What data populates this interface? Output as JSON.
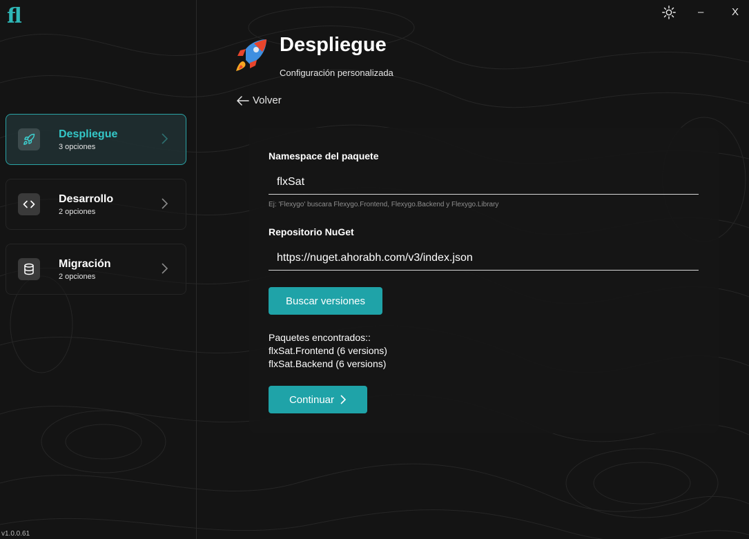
{
  "app": {
    "logo_text": "fl",
    "version": "v1.0.0.61"
  },
  "window_controls": {
    "theme_icon": "sun-icon",
    "minimize": "–",
    "close": "X"
  },
  "sidebar": {
    "items": [
      {
        "title": "Despliegue",
        "subtitle": "3 opciones",
        "icon": "rocket-icon",
        "active": true
      },
      {
        "title": "Desarrollo",
        "subtitle": "2 opciones",
        "icon": "code-icon",
        "active": false
      },
      {
        "title": "Migración",
        "subtitle": "2 opciones",
        "icon": "database-icon",
        "active": false
      }
    ]
  },
  "header": {
    "title": "Despliegue",
    "subtitle": "Configuración personalizada",
    "back_label": "Volver"
  },
  "form": {
    "namespace_label": "Namespace del paquete",
    "namespace_value": "flxSat",
    "namespace_hint": "Ej: 'Flexygo' buscara Flexygo.Frontend, Flexygo.Backend y Flexygo.Library",
    "repo_label": "Repositorio NuGet",
    "repo_value": "https://nuget.ahorabh.com/v3/index.json",
    "search_button": "Buscar versiones",
    "results_title": "Paquetes encontrados::",
    "results": [
      "flxSat.Frontend (6 versions)",
      "flxSat.Backend (6 versions)"
    ],
    "continue_button": "Continuar"
  },
  "colors": {
    "accent": "#1fa3a8",
    "background": "#141414",
    "card": "#161616"
  }
}
